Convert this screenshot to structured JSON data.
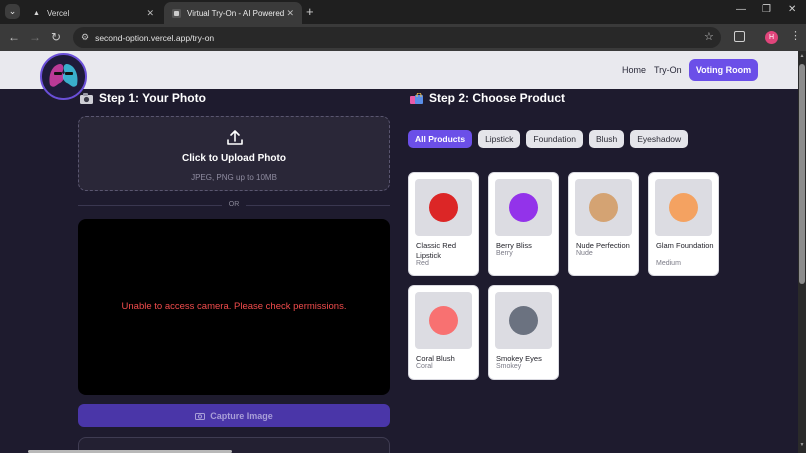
{
  "browser": {
    "tabs": [
      {
        "title": "Vercel",
        "active": false
      },
      {
        "title": "Virtual Try-On - AI Powered",
        "active": true
      }
    ],
    "url": "second-option.vercel.app/try-on",
    "profile_initial": "H"
  },
  "nav": {
    "links": [
      "Home",
      "Try-On"
    ],
    "cta_label": "Voting Room"
  },
  "step1": {
    "title": "Step 1: Your Photo",
    "upload_title": "Click to Upload Photo",
    "upload_sub": "JPEG, PNG up to 10MB",
    "or_label": "OR",
    "camera_error": "Unable to access camera. Please check permissions.",
    "capture_label": "Capture Image"
  },
  "step2": {
    "title": "Step 2: Choose Product",
    "filters": [
      "All Products",
      "Lipstick",
      "Foundation",
      "Blush",
      "Eyeshadow"
    ],
    "active_filter": "All Products",
    "products": [
      {
        "name": "Classic Red Lipstick",
        "shade": "Red",
        "color": "#dc2626"
      },
      {
        "name": "Berry Bliss",
        "shade": "Berry",
        "color": "#9333ea"
      },
      {
        "name": "Nude Perfection",
        "shade": "Nude",
        "color": "#d4a373"
      },
      {
        "name": "Glam Foundation",
        "shade": "Medium",
        "color": "#f4a261"
      },
      {
        "name": "Coral Blush",
        "shade": "Coral",
        "color": "#f87171"
      },
      {
        "name": "Smokey Eyes",
        "shade": "Smokey",
        "color": "#6b7280"
      }
    ]
  },
  "colors": {
    "accent": "#6b4fe8",
    "page_bg": "#1e1b2e",
    "error": "#f14c4c"
  }
}
